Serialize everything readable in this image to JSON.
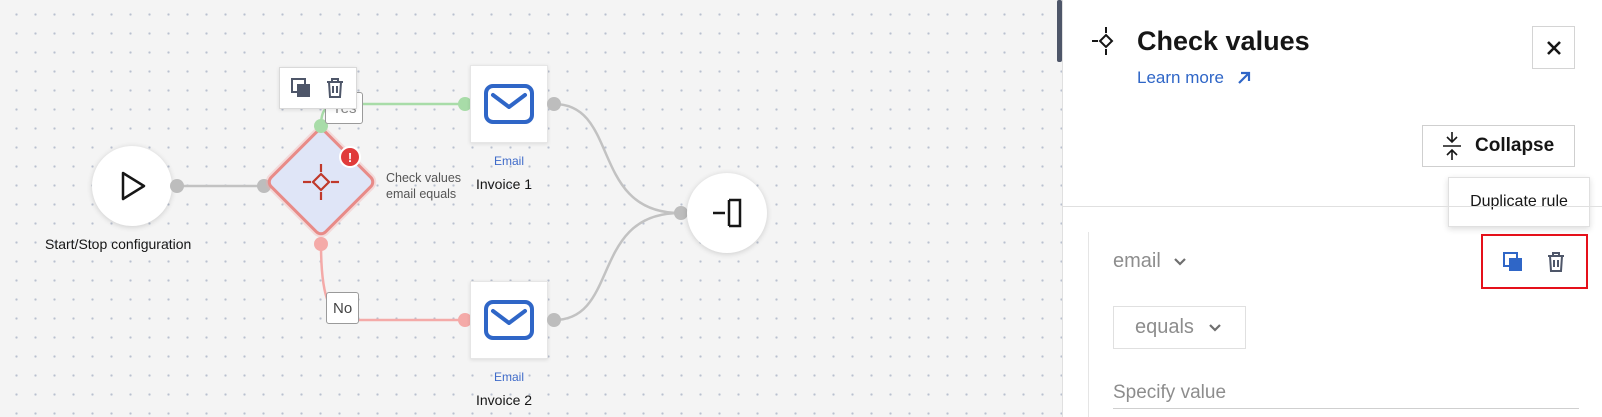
{
  "canvas": {
    "start_label": "Start/Stop configuration",
    "condition": {
      "line1": "Check values",
      "line2": "email equals",
      "error_mark": "!"
    },
    "branches": {
      "yes": "Yes",
      "no": "No"
    },
    "email_nodes": [
      {
        "type": "Email",
        "name": "Invoice 1"
      },
      {
        "type": "Email",
        "name": "Invoice 2"
      }
    ]
  },
  "panel": {
    "title": "Check values",
    "learn_more": "Learn more",
    "collapse_label": "Collapse",
    "tooltip": "Duplicate rule",
    "rule": {
      "field": "email",
      "operator": "equals",
      "value_placeholder": "Specify value"
    }
  },
  "colors": {
    "accent": "#2f66c7",
    "error": "#e03b3b",
    "highlight_border": "#e5101a",
    "yes_wire": "#a8dca8",
    "no_wire": "#f4aaa8"
  }
}
